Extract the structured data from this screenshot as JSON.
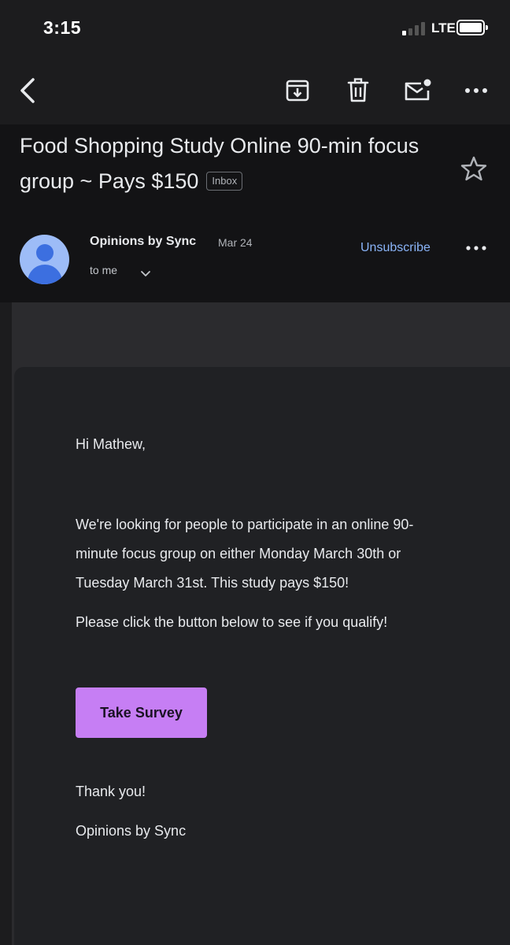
{
  "status_bar": {
    "time": "3:15",
    "network": "LTE",
    "signal_bars_active": 1,
    "signal_bars_total": 4
  },
  "toolbar": {
    "back_icon": "chevron-left-icon",
    "archive_icon": "archive-icon",
    "delete_icon": "trash-icon",
    "mark_unread_icon": "mail-unread-icon",
    "more_icon": "more-horizontal-icon"
  },
  "email": {
    "subject": "Food Shopping Study Online 90-min focus group ~ Pays $150",
    "label": "Inbox",
    "sender": "Opinions by Sync",
    "date": "Mar 24",
    "recipient": "to me",
    "unsubscribe_label": "Unsubscribe",
    "body": {
      "greeting": "Hi Mathew,",
      "paragraph1": "We're looking for people to participate in an online 90-minute focus group on either Monday March 30th or Tuesday March 31st. This study pays $150!",
      "paragraph2": "Please click the button below to see if you qualify!",
      "button_label": "Take Survey",
      "thanks": "Thank you!",
      "signoff": "Opinions by Sync"
    }
  },
  "colors": {
    "background": "#1c1c1e",
    "header_bg": "#131315",
    "card_bg": "#202124",
    "link": "#8ab4f8",
    "button": "#c67ef4",
    "avatar_bg": "#9dbcf7",
    "avatar_fg": "#3c6fe0"
  }
}
